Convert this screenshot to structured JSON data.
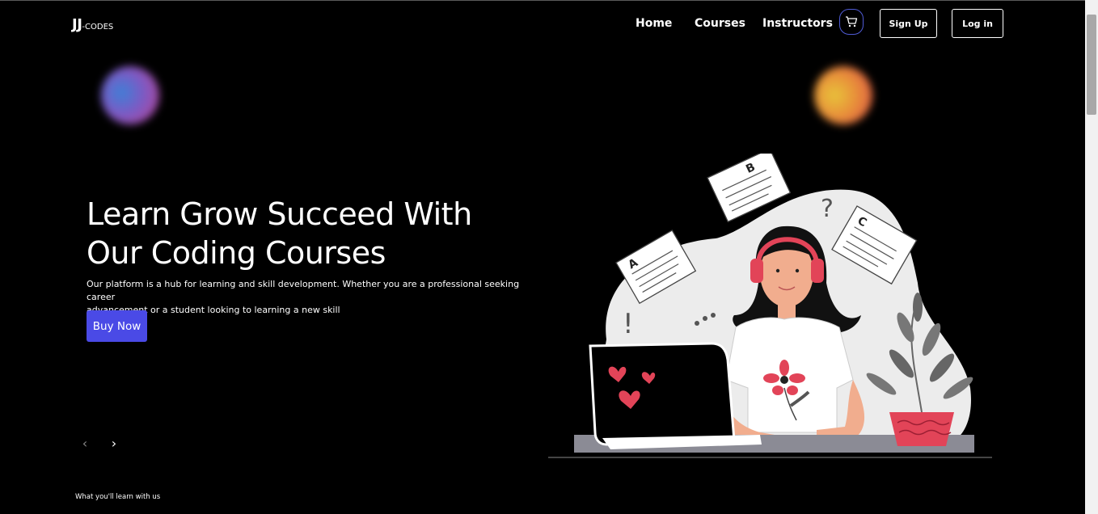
{
  "nav": {
    "logo_main": "JJ",
    "logo_sub": "-CODES",
    "links": [
      "Home",
      "Courses",
      "Instructors"
    ],
    "cart_icon": "cart-icon",
    "signup_label": "Sign Up",
    "login_label": "Log in"
  },
  "hero": {
    "headline_line1": "Learn Grow Succeed With",
    "headline_line2": "Our Coding Courses",
    "description_line1": "Our platform is a hub for learning and skill development. Whether you are a professional seeking career",
    "description_line2": "advancement or a student looking to learning a new skill",
    "cta_label": "Buy Now",
    "prev_arrow": "‹",
    "next_arrow": "›",
    "illustration_letters": [
      "A",
      "B",
      "C"
    ],
    "illustration_marks": [
      "?",
      "!"
    ]
  },
  "section": {
    "caption": "What you'll learn with us"
  },
  "colors": {
    "background": "#000000",
    "accent": "#4a4ae6",
    "cart_border": "#4f5bd5",
    "illustration_red": "#e24458"
  }
}
